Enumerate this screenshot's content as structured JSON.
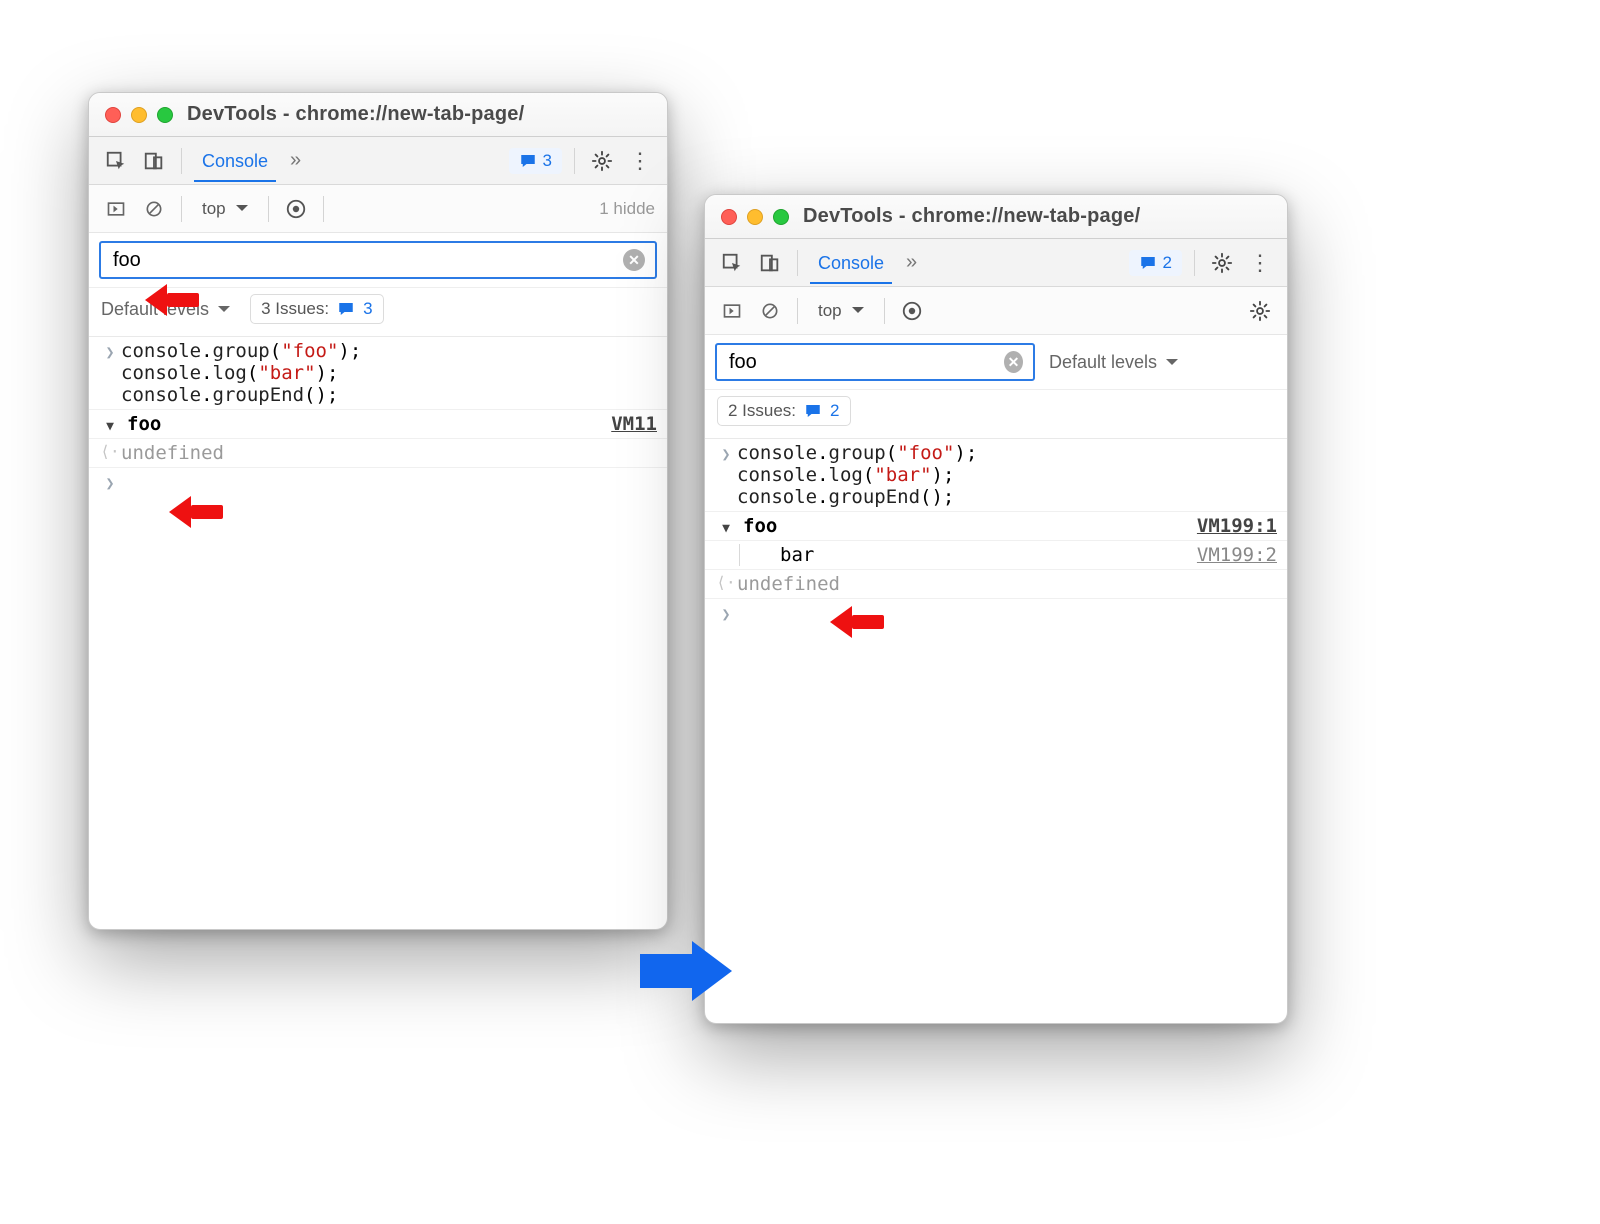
{
  "window_a": {
    "title": "DevTools - chrome://new-tab-page/",
    "tab_active": "Console",
    "badge_count": "3",
    "context": "top",
    "hidden_text": "1 hidde",
    "filter_value": "foo",
    "levels_label": "Default levels",
    "issues_label": "3 Issues:",
    "issues_badge": "3",
    "code_lines": [
      "console.group(\"foo\");",
      "console.log(\"bar\");",
      "console.groupEnd();"
    ],
    "group_name": "foo",
    "group_source": "VM11",
    "undefined_label": "undefined"
  },
  "window_b": {
    "title": "DevTools - chrome://new-tab-page/",
    "tab_active": "Console",
    "badge_count": "2",
    "context": "top",
    "filter_value": "foo",
    "levels_label": "Default levels",
    "issues_label": "2 Issues:",
    "issues_badge": "2",
    "code_lines": [
      "console.group(\"foo\");",
      "console.log(\"bar\");",
      "console.groupEnd();"
    ],
    "group_name": "foo",
    "group_source": "VM199:1",
    "bar_label": "bar",
    "bar_source": "VM199:2",
    "undefined_label": "undefined"
  }
}
